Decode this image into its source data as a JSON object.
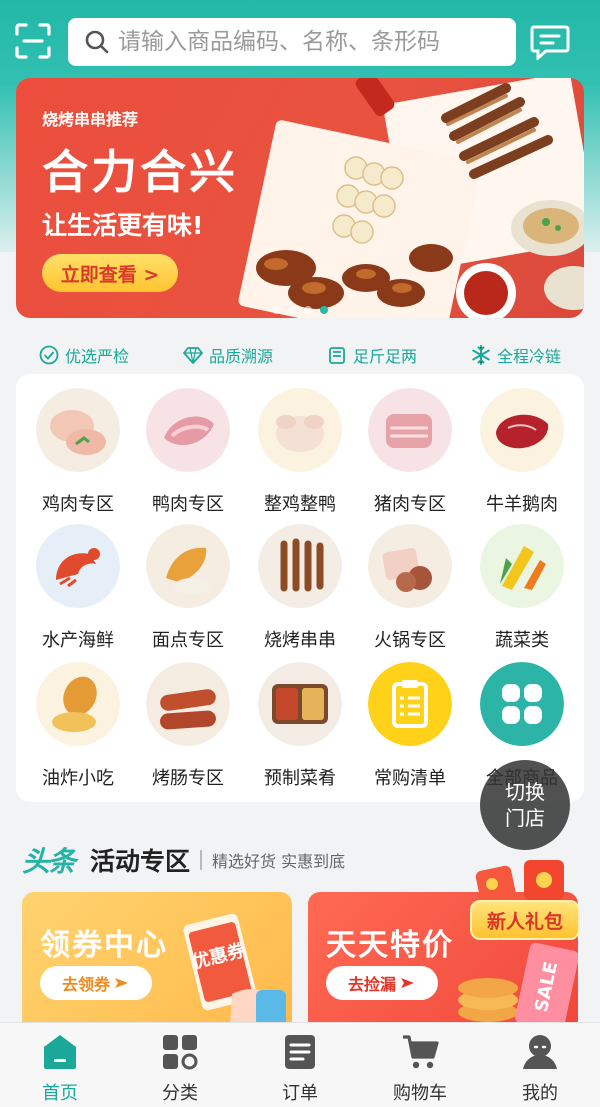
{
  "header": {
    "search_placeholder": "请输入商品编码、名称、条形码",
    "icons": [
      "scan-icon",
      "search-icon",
      "message-icon"
    ]
  },
  "banner": {
    "subtitle": "烧烤串串推荐",
    "title": "合力合兴",
    "slogan": "让生活更有味!",
    "cta": "立即查看 >",
    "dot_count": 4,
    "active_dot": 3
  },
  "features": [
    {
      "icon": "check-circle-icon",
      "label": "优选严检"
    },
    {
      "icon": "diamond-icon",
      "label": "品质溯源"
    },
    {
      "icon": "scale-icon",
      "label": "足斤足两"
    },
    {
      "icon": "snowflake-icon",
      "label": "全程冷链"
    }
  ],
  "categories": [
    {
      "label": "鸡肉专区",
      "icon": "chicken-meat-icon"
    },
    {
      "label": "鸭肉专区",
      "icon": "duck-meat-icon"
    },
    {
      "label": "整鸡整鸭",
      "icon": "whole-chicken-icon"
    },
    {
      "label": "猪肉专区",
      "icon": "pork-icon"
    },
    {
      "label": "牛羊鹅肉",
      "icon": "beef-icon"
    },
    {
      "label": "水产海鲜",
      "icon": "seafood-icon"
    },
    {
      "label": "面点专区",
      "icon": "pastry-icon"
    },
    {
      "label": "烧烤串串",
      "icon": "skewer-icon"
    },
    {
      "label": "火锅专区",
      "icon": "hotpot-icon"
    },
    {
      "label": "蔬菜类",
      "icon": "vegetable-icon"
    },
    {
      "label": "油炸小吃",
      "icon": "fried-snack-icon"
    },
    {
      "label": "烤肠专区",
      "icon": "sausage-icon"
    },
    {
      "label": "预制菜肴",
      "icon": "prepared-dish-icon"
    },
    {
      "label": "常购清单",
      "icon": "clipboard-icon"
    },
    {
      "label": "全部商品",
      "icon": "grid-icon"
    }
  ],
  "switch_store": {
    "line1": "切换",
    "line2": "门店"
  },
  "activity": {
    "logo": "头条",
    "title": "活动专区",
    "subtitle": "精选好货 实惠到底",
    "promos": [
      {
        "title": "领券中心",
        "button": "去领券",
        "badge": "优惠券"
      },
      {
        "title": "天天特价",
        "button": "去捡漏",
        "badge": "SALE"
      }
    ],
    "newbie_label": "新人礼包"
  },
  "tabs": [
    {
      "label": "首页",
      "icon": "home-icon",
      "active": true
    },
    {
      "label": "分类",
      "icon": "category-icon",
      "active": false
    },
    {
      "label": "订单",
      "icon": "order-icon",
      "active": false
    },
    {
      "label": "购物车",
      "icon": "cart-icon",
      "active": false
    },
    {
      "label": "我的",
      "icon": "user-icon",
      "active": false
    }
  ],
  "colors": {
    "primary": "#23b7a8",
    "banner_red": "#e8533f",
    "cta_yellow": "#ffd047"
  }
}
